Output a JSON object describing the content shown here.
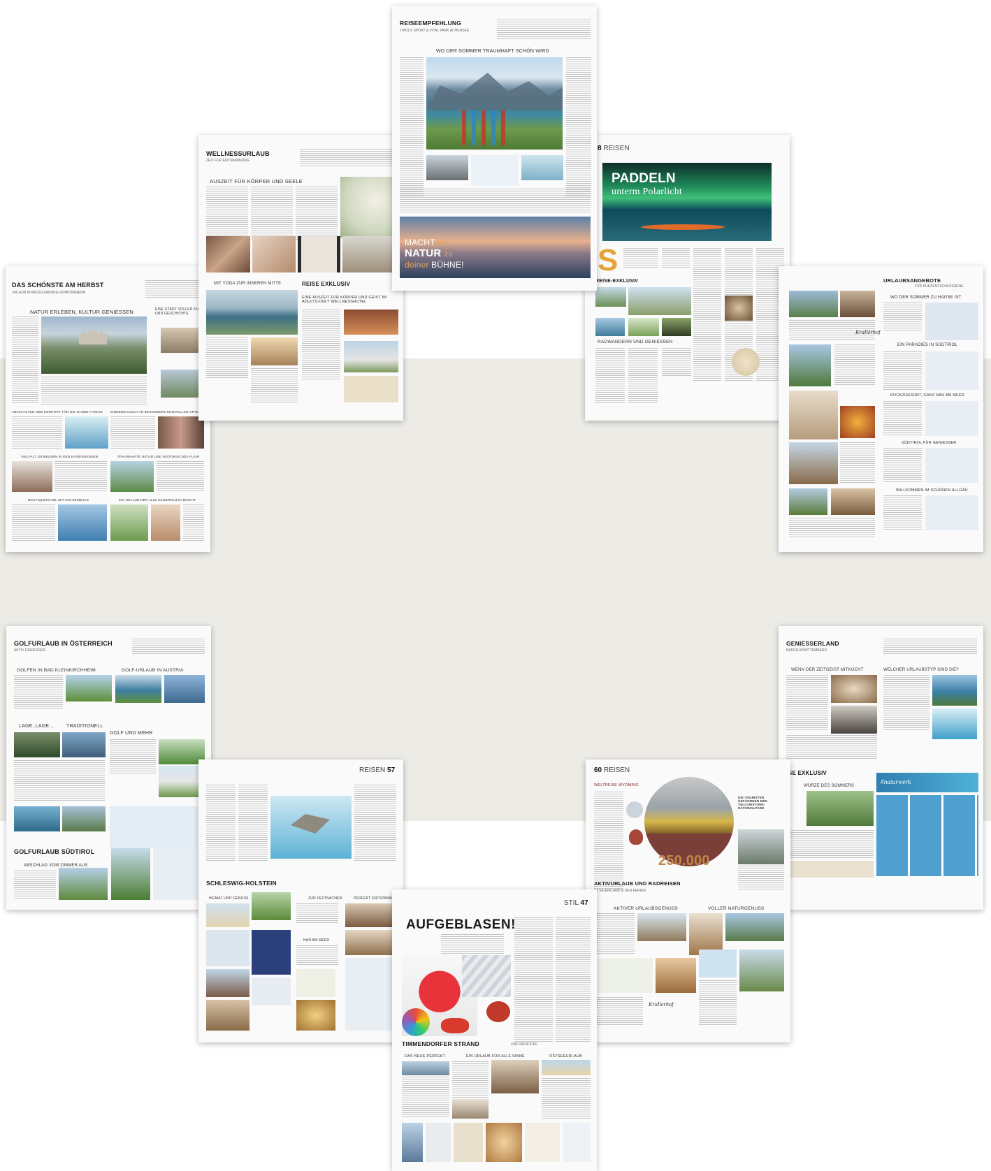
{
  "colors": {
    "background": "#ffffff",
    "band": "#ecebe6"
  },
  "pages": {
    "top_center": {
      "title": "REISEEMPFEHLUNG",
      "subtitle": "TIROLS SPORT & VITAL PARK ACHENSEE",
      "headline": "WO DER SOMMER TRAUMHAFT SCHÖN WIRD",
      "ad_line1": "MACHT",
      "ad_line1b": "die",
      "ad_line2": "NATUR",
      "ad_line2b": "zu",
      "ad_line3a": "deiner",
      "ad_line3": "BÜHNE!"
    },
    "wellness": {
      "title": "WELLNESSURLAUB",
      "subtitle": "ZEIT FÜR ENTSPANNUNG",
      "headline1": "AUSZEIT FÜR KÖRPER UND SEELE",
      "headline2": "MIT YOGA ZUR INNEREN MITTE",
      "title2": "REISE EXKLUSIV",
      "headline3": "EINE AUSZEIT FÜR KÖRPER UND GEIST IM ADULTS-ONLY WELLNESSHOTEL"
    },
    "reisen_polar": {
      "page_number": "8",
      "section": "REISEN",
      "headline_a": "PADDELN",
      "headline_b": "unterm Polarlicht",
      "dropcap": "S",
      "title2": "REISE-EXKLUSIV",
      "headline2": "RADWANDERN UND GENIESSEN"
    },
    "herbst": {
      "title": "DAS SCHÖNSTE AM HERBST",
      "subtitle": "URLAUB IN MECKLENBURG-VORPOMMERN",
      "headline1": "NATUR ERLEBEN, KULTUR GENIESSEN",
      "headline2": "EINE STADT VOLLER KUNST UND GESCHICHTE",
      "headline3": "ABSCHALTEN UND KOMFORT FÜR DIE GANZE FAMILIE",
      "headline4": "SINNENRAUSCH AN BESONDERS REIZVOLLEN ORTEN",
      "headline5": "VIELFALT GENIESSEN IN DEN KAISERBÄDERN",
      "headline6": "TRAUMHAFTE NATUR UND HISTORISCHES FLAIR",
      "headline7": "BOUTIQUEHOTEL MIT OSTSEEBLICK",
      "headline8": "EIN URLAUB DER ALLE SILBERGLÜCK BRICHT"
    },
    "angebote": {
      "title": "URLAUBSANGEBOTE",
      "subtitle": "FÜR KURZENTSCHLOSSENE",
      "headline1": "WO DER SOMMER ZU HAUSE IST",
      "headline2": "EIN PARADIES IN SÜDTIROL",
      "headline3": "RÜCKZUGSORT, GANZ NAH AM MEER",
      "headline4": "SÜDTIROL FÜR GENIESSER",
      "headline5": "WILLKOMMEN IM SCHÖNEN ALLGÄU",
      "logo": "Krallerhof"
    },
    "golf": {
      "title": "GOLFURLAUB IN ÖSTERREICH",
      "subtitle": "AKTIV GENIESSEN",
      "headline1": "GOLFEN IN BAD KLEINKIRCHHEIM",
      "headline2": "GOLF-URLAUB IN AUSTRIA",
      "headline3": "LAGE, LAGE…",
      "headline4": "TRADITIONELL",
      "headline5": "GOLF UND MEHR",
      "title2": "GOLFURLAUB SÜDTIROL",
      "headline6": "ABSCHLAG VOM ZIMMER AUS"
    },
    "geniesser": {
      "title": "GENIESSERLAND",
      "subtitle": "BADEN-WÜRTTEMBERG",
      "headline1": "WENN DER ZEITGEIST MITKOCHT",
      "headline2": "WELCHER URLAUBSTYP SIND SIE?",
      "title2": "EISE EXKLUSIV",
      "headline3": "WÜRZE DES SOMMERS",
      "brand": "#naturwerk"
    },
    "reisen57": {
      "section": "REISEN",
      "page_number": "57",
      "title2": "SCHLESWIG-HOLSTEIN",
      "headline1": "HEIMAT UND GENUSS",
      "headline2": "ZUR FESTNACHEN",
      "headline3": "PERFEKT ENTSPANNEN",
      "headline4": "HAN AM MEER"
    },
    "reisen60": {
      "page_number": "60",
      "section": "REISEN",
      "kicker": "WELTREISE WYOMING",
      "headline": "DIE TOURISTEN GEFÄHRDEN DEN YELLOWSTONE-NATIONALPARK",
      "number": "250.000",
      "title2": "AKTIVURLAUB UND RADREISEN",
      "subtitle2": "IM SAUERLAND & DEN FERIEN",
      "headline2": "AKTIVER URLAUBSGENUSS",
      "headline3": "VOLLER NATURGENUSS",
      "logo": "Krallerhof"
    },
    "stil": {
      "section": "STIL",
      "page_number": "47",
      "headline": "AUFGEBLASEN!",
      "title2": "TIMMENDORFER STRAND",
      "subtitle2": "UND NIENDORF",
      "headline2": "DAS NEUE PERFEKT",
      "headline3": "EIN URLAUB FÜR ALLE SINNE",
      "headline4": "OSTSEEURLAUB"
    }
  }
}
